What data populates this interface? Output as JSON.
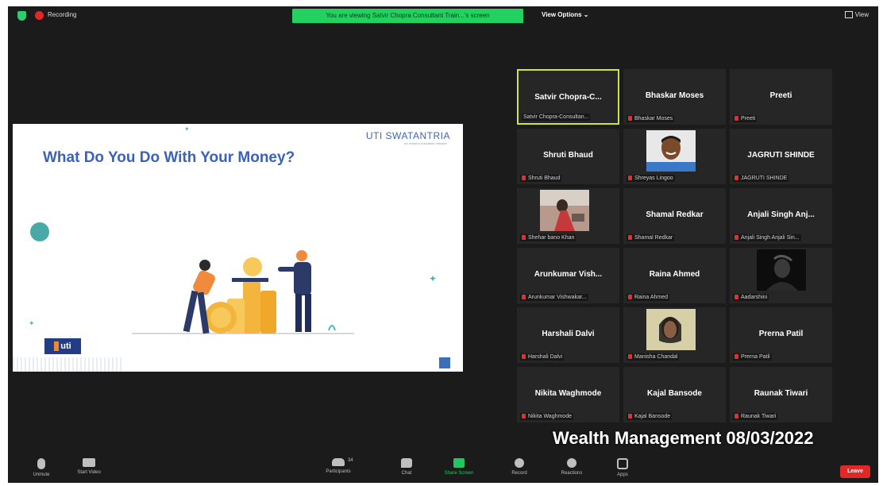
{
  "top_bar": {
    "recording_label": "Recording",
    "viewing_banner": "You are viewing Satvir Chopra Consultant Train...'s screen",
    "view_options_label": "View Options",
    "view_button_label": "View"
  },
  "shared_slide": {
    "title": "What Do You Do With Your Money?",
    "logo_text": "UTI SWATANTRIA",
    "logo_subtext": "An investor education initiative",
    "uti_logo_text": "uti"
  },
  "participants": [
    {
      "display_name": "Satvir Chopra-C...",
      "label": "Satvir Chopra-Consultan...",
      "active": true
    },
    {
      "display_name": "Bhaskar Moses",
      "label": "Bhaskar Moses"
    },
    {
      "display_name": "Preeti",
      "label": "Preeti"
    },
    {
      "display_name": "Shruti Bhaud",
      "label": "Shruti Bhaud"
    },
    {
      "display_name": "",
      "label": "Shreyas Lingoo",
      "photo": true
    },
    {
      "display_name": "JAGRUTI SHINDE",
      "label": "JAGRUTI SHINDE"
    },
    {
      "display_name": "",
      "label": "Shehar bano Khan",
      "photo": true
    },
    {
      "display_name": "Shamal Redkar",
      "label": "Shamal Redkar"
    },
    {
      "display_name": "Anjali Singh Anj...",
      "label": "Anjali Singh Anjali Sin..."
    },
    {
      "display_name": "Arunkumar Vish...",
      "label": "Arunkumar Vishwakar..."
    },
    {
      "display_name": "Raina Ahmed",
      "label": "Raina Ahmed"
    },
    {
      "display_name": "",
      "label": "Aadarshini",
      "photo": true
    },
    {
      "display_name": "Harshali Dalvi",
      "label": "Harshali Dalvi"
    },
    {
      "display_name": "",
      "label": "Manisha Chandal",
      "photo": true
    },
    {
      "display_name": "Prerna Patil",
      "label": "Prerna Patil"
    },
    {
      "display_name": "Nikita Waghmode",
      "label": "Nikita Waghmode"
    },
    {
      "display_name": "Kajal Bansode",
      "label": "Kajal Bansode"
    },
    {
      "display_name": "Raunak Tiwari",
      "label": "Raunak Tiwari"
    }
  ],
  "watermark": "Wealth Management 08/03/2022",
  "toolbar": {
    "unmute": "Unmute",
    "start_video": "Start Video",
    "participants": "Participants",
    "participants_count": "34",
    "chat": "Chat",
    "share_screen": "Share Screen",
    "record": "Record",
    "reactions": "Reactions",
    "apps": "Apps",
    "leave": "Leave"
  },
  "colors": {
    "banner_green": "#23d160",
    "active_speaker_border": "#c8e64b",
    "leave_red": "#e02828",
    "slide_title_blue": "#3a62b8"
  }
}
